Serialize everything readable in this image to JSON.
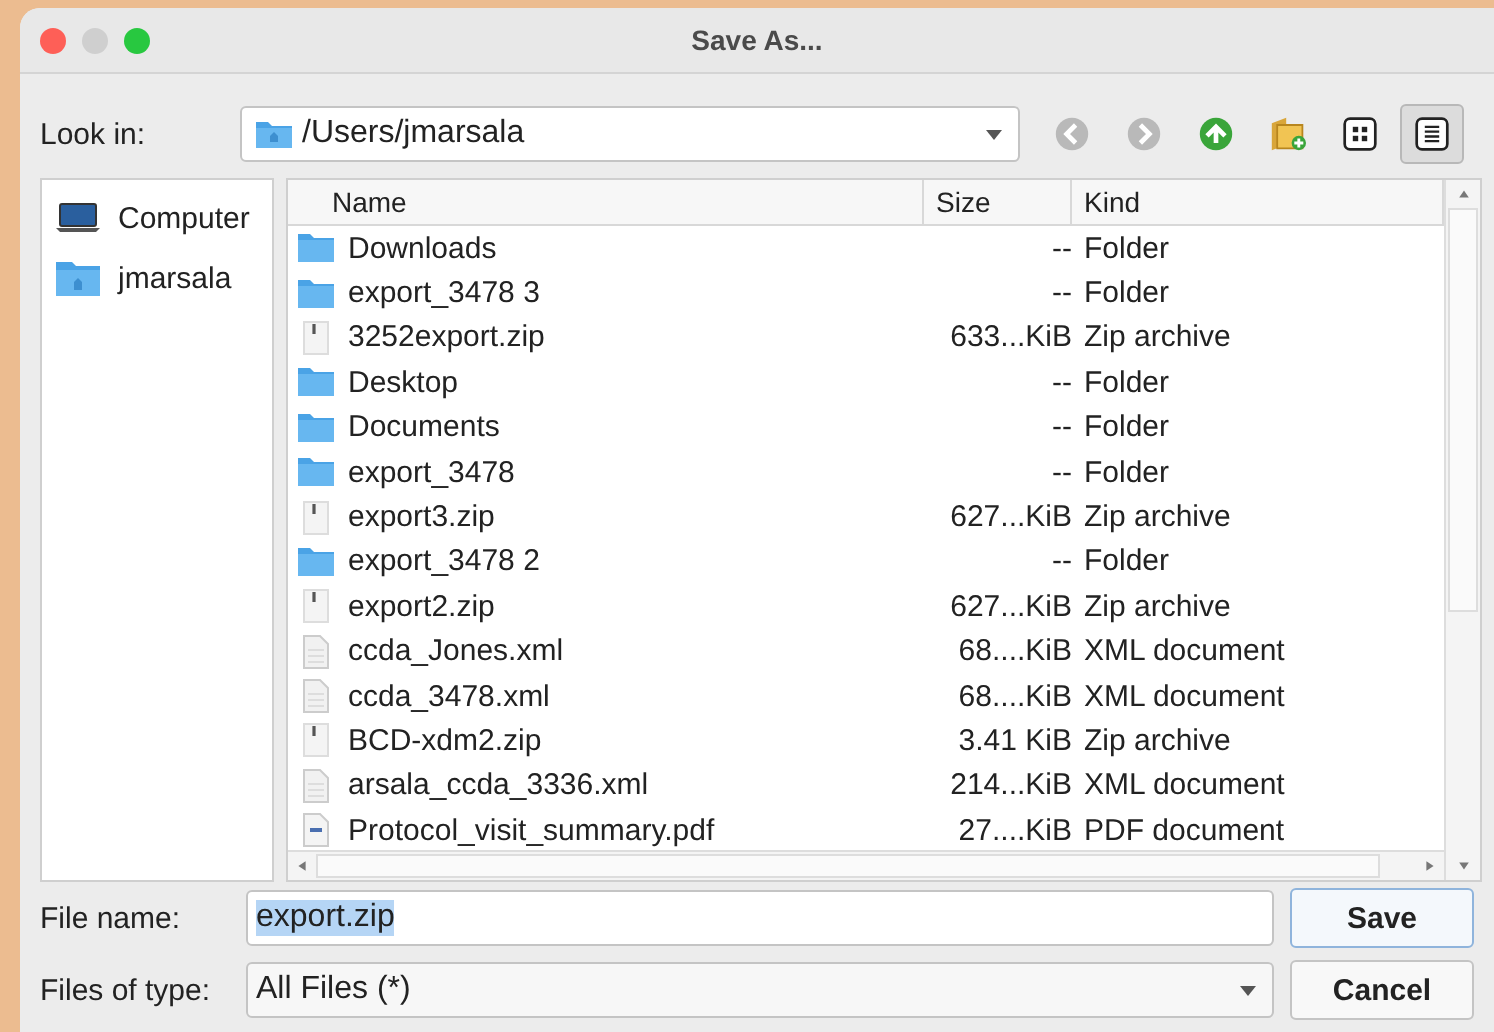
{
  "window": {
    "title": "Save As..."
  },
  "look_in": {
    "label": "Look in:",
    "path": "/Users/jmarsala"
  },
  "toolbar": [
    {
      "kind": "back",
      "disabled": true
    },
    {
      "kind": "forward",
      "disabled": true
    },
    {
      "kind": "up",
      "disabled": false
    },
    {
      "kind": "new_folder"
    },
    {
      "kind": "icon_view",
      "selected": false
    },
    {
      "kind": "detail_view",
      "selected": true
    }
  ],
  "sidebar": {
    "items": [
      {
        "label": "Computer",
        "kind": "computer",
        "selected": false
      },
      {
        "label": "jmarsala",
        "kind": "home",
        "selected": false
      }
    ]
  },
  "table": {
    "columns": [
      "Name",
      "Size",
      "Kind"
    ],
    "rows": [
      {
        "name": "Downloads",
        "size": "--",
        "kind_text": "Folder",
        "kind": "folder"
      },
      {
        "name": "export_3478 3",
        "size": "--",
        "kind_text": "Folder",
        "kind": "folder"
      },
      {
        "name": "3252export.zip",
        "size": "633...KiB",
        "kind_text": "Zip archive",
        "kind": "zip"
      },
      {
        "name": "Desktop",
        "size": "--",
        "kind_text": "Folder",
        "kind": "folder"
      },
      {
        "name": "Documents",
        "size": "--",
        "kind_text": "Folder",
        "kind": "folder"
      },
      {
        "name": "export_3478",
        "size": "--",
        "kind_text": "Folder",
        "kind": "folder"
      },
      {
        "name": "export3.zip",
        "size": "627...KiB",
        "kind_text": "Zip archive",
        "kind": "zip"
      },
      {
        "name": "export_3478 2",
        "size": "--",
        "kind_text": "Folder",
        "kind": "folder"
      },
      {
        "name": "export2.zip",
        "size": "627...KiB",
        "kind_text": "Zip archive",
        "kind": "zip"
      },
      {
        "name": "ccda_Jones.xml",
        "size": "68....KiB",
        "kind_text": "XML document",
        "kind": "xml"
      },
      {
        "name": "ccda_3478.xml",
        "size": "68....KiB",
        "kind_text": "XML document",
        "kind": "xml"
      },
      {
        "name": "BCD-xdm2.zip",
        "size": "3.41 KiB",
        "kind_text": "Zip archive",
        "kind": "zip"
      },
      {
        "name": "arsala_ccda_3336.xml",
        "size": "214...KiB",
        "kind_text": "XML document",
        "kind": "xml"
      },
      {
        "name": "Protocol_visit_summary.pdf",
        "size": "27....KiB",
        "kind_text": "PDF document",
        "kind": "pdf"
      }
    ]
  },
  "file_name": {
    "label": "File name:",
    "value": "export.zip",
    "text_selected": true
  },
  "file_type": {
    "label": "Files of type:",
    "value": "All Files (*)"
  },
  "buttons": [
    {
      "label": "Save",
      "default": true
    },
    {
      "label": "Cancel",
      "default": false
    }
  ]
}
